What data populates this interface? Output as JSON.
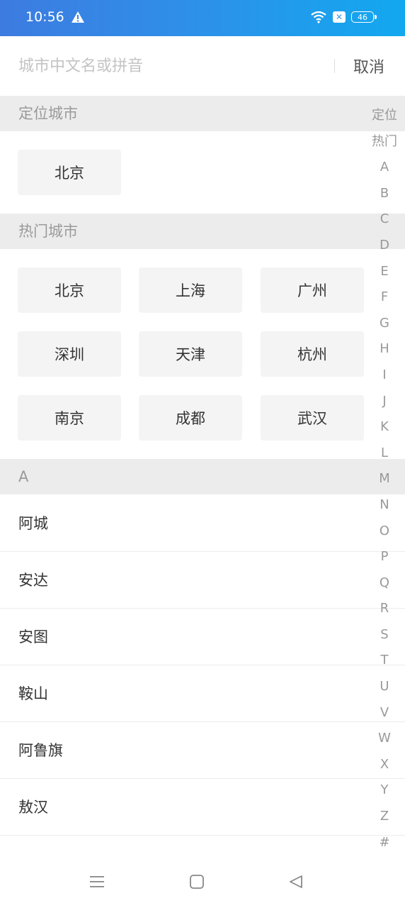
{
  "status_bar": {
    "time": "10:56",
    "battery": "46",
    "icons": [
      "warning-icon",
      "wifi-icon",
      "sim-x-icon",
      "battery-icon"
    ]
  },
  "search": {
    "placeholder": "城市中文名或拼音",
    "value": "",
    "cancel_label": "取消"
  },
  "location_section": {
    "title": "定位城市",
    "city": "北京"
  },
  "hot_section": {
    "title": "热门城市",
    "cities": [
      "北京",
      "上海",
      "广州",
      "深圳",
      "天津",
      "杭州",
      "南京",
      "成都",
      "武汉"
    ]
  },
  "letter_section": {
    "title": "A",
    "cities": [
      "阿城",
      "安达",
      "安图",
      "鞍山",
      "阿鲁旗",
      "敖汉"
    ]
  },
  "index_bar": [
    "定位",
    "热门",
    "A",
    "B",
    "C",
    "D",
    "E",
    "F",
    "G",
    "H",
    "I",
    "J",
    "K",
    "L",
    "M",
    "N",
    "O",
    "P",
    "Q",
    "R",
    "S",
    "T",
    "U",
    "V",
    "W",
    "X",
    "Y",
    "Z",
    "#"
  ],
  "nav_bar": {
    "icons": [
      "menu-icon",
      "home-icon",
      "back-icon"
    ]
  },
  "colors": {
    "status_gradient_start": "#3d7be0",
    "status_gradient_end": "#12a8ef",
    "section_bg": "#ececec",
    "chip_bg": "#f4f4f4"
  }
}
